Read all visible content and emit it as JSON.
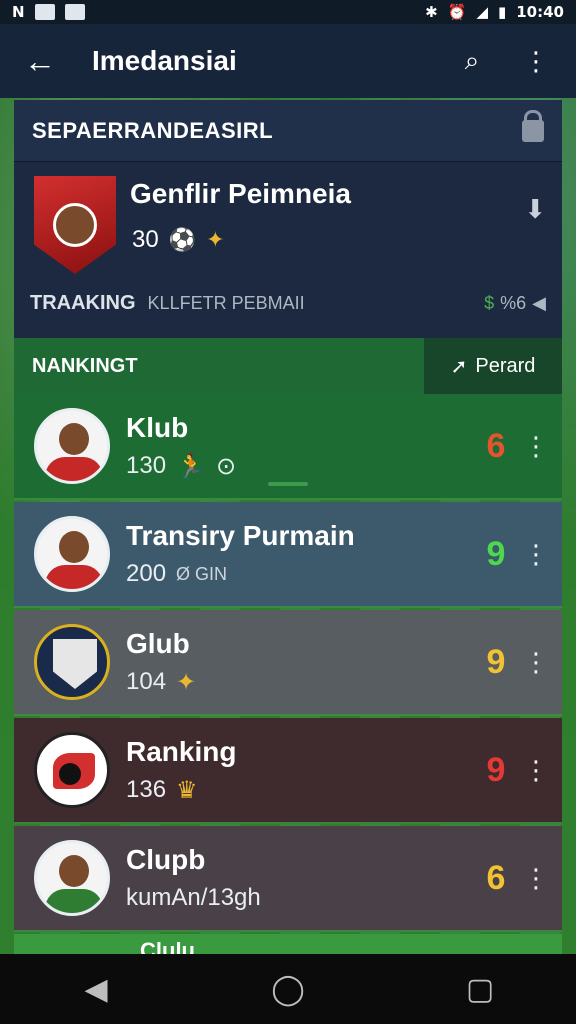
{
  "status_bar": {
    "left_text": "N",
    "time": "10:40"
  },
  "app_bar": {
    "title": "Imedansiai"
  },
  "section": {
    "header_label": "SEPAERRANDEASIRL"
  },
  "featured": {
    "name": "Genflir Peimneia",
    "number": "30",
    "tracking_label": "TRAAKING",
    "tracking_sub": "KLLFETR PEBMAII",
    "percent": "%6"
  },
  "ranking": {
    "label": "NANKINGT",
    "forward_label": "Perard"
  },
  "rows": [
    {
      "name": "Klub",
      "value": "130",
      "chip": "",
      "score": "6",
      "score_color": "#e5532f"
    },
    {
      "name": "Transiry Purmain",
      "value": "200",
      "chip": "Ø GIN",
      "score": "9",
      "score_color": "#4cd94c"
    },
    {
      "name": "Glub",
      "value": "104",
      "chip": "",
      "score": "9",
      "score_color": "#f1c232"
    },
    {
      "name": "Ranking",
      "value": "136",
      "chip": "",
      "score": "9",
      "score_color": "#e53935"
    },
    {
      "name": "Clupb",
      "value": "kumAn/13gh",
      "chip": "",
      "score": "6",
      "score_color": "#f1c232"
    }
  ],
  "partial_row": {
    "name": "Clulu"
  },
  "colors": {
    "app_bar": "#17253a",
    "ranking_bar": "#1f6a34"
  }
}
